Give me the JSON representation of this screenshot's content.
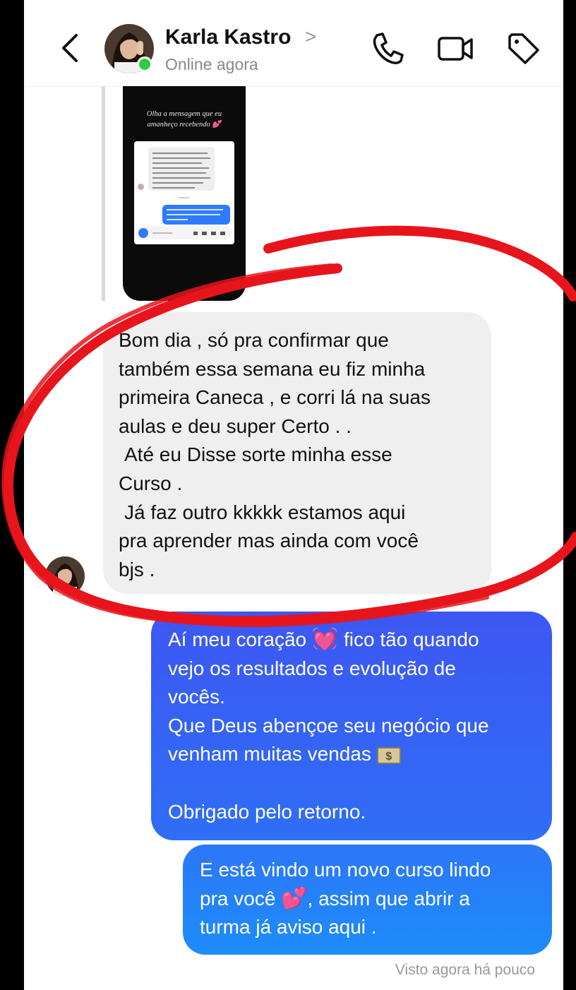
{
  "header": {
    "contact_name": "Karla Kastro",
    "name_chevron": ">",
    "status": "Online agora"
  },
  "story_reply": {
    "caption_line1": "Olha a mensagem que eu",
    "caption_line2": "amanheço recebendo"
  },
  "messages": {
    "incoming": {
      "lines": [
        "Bom dia , só pra confirmar que",
        "também essa semana eu fiz minha",
        "primeira Caneca , e corri lá na suas",
        "aulas e deu super Certo . .",
        "Até eu Disse sorte minha esse",
        "Curso .",
        "Já faz outro kkkkk estamos aqui",
        "pra aprender mas ainda com você",
        "bjs ."
      ]
    },
    "outgoing_1": {
      "line1_before": "Aí meu coração",
      "line1_emoji": "💓",
      "line1_after": "fico tão quando",
      "line2": "vejo os resultados e evolução de",
      "line3": "vocês.",
      "line4": "Que Deus abençoe seu negócio que",
      "line5_text": "venham muitas vendas",
      "line5_emoji": "💵",
      "line6": "Obrigado pelo retorno."
    },
    "outgoing_2": {
      "line1": "E está vindo um novo curso lindo",
      "line2_before": "pra você",
      "line2_emoji": "💕",
      "line2_after": ", assim que abrir a",
      "line3": "turma já aviso aqui ."
    }
  },
  "seen_status": "Visto agora há pouco",
  "icons": [
    "back-arrow-icon",
    "phone-icon",
    "video-camera-icon",
    "tag-icon"
  ],
  "colors": {
    "outgoing_bubble": "#3d57f2",
    "incoming_bubble": "#efefef",
    "online_dot": "#2ecc40",
    "annotation_red": "#e8141c"
  }
}
